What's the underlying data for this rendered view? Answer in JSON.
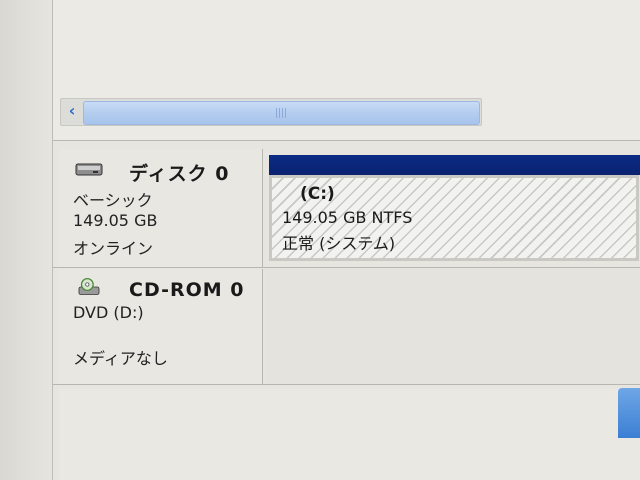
{
  "disks": [
    {
      "title": "ディスク 0",
      "type": "ベーシック",
      "size": "149.05 GB",
      "status": "オンライン",
      "icon": "hard-disk-icon",
      "partition": {
        "drive": "(C:)",
        "fs": "149.05 GB NTFS",
        "health": "正常 (システム)"
      }
    },
    {
      "title": "CD-ROM 0",
      "type": "DVD (D:)",
      "media": "メディアなし",
      "icon": "cd-rom-icon"
    }
  ],
  "colors": {
    "partition_header": "#0b2b86",
    "scrollbar_thumb": "#b4cdef"
  }
}
